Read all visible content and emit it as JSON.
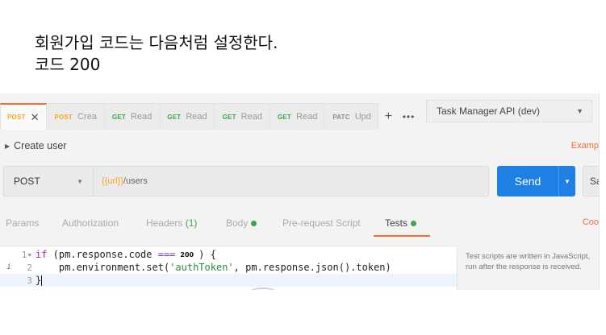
{
  "caption": {
    "line1": "회원가입 코드는 다음처럼 설정한다.",
    "line2": "코드 200"
  },
  "tabs": [
    {
      "method": "POST",
      "name": "",
      "active": true,
      "close": "✕"
    },
    {
      "method": "POST",
      "name": "Crea"
    },
    {
      "method": "GET",
      "name": "Read"
    },
    {
      "method": "GET",
      "name": "Read"
    },
    {
      "method": "GET",
      "name": "Read"
    },
    {
      "method": "GET",
      "name": "Read"
    },
    {
      "method": "PATC",
      "name": "Upd"
    }
  ],
  "tab_add": "+",
  "tab_more": "•••",
  "environment": {
    "label": "Task Manager API (dev)",
    "caret": "▼"
  },
  "request": {
    "name": "Create user",
    "examples_label": "Examp",
    "method": "POST",
    "method_caret": "▼",
    "url_var": "{{url}}",
    "url_path": "/users",
    "send_label": "Send",
    "send_caret": "▼",
    "save_label": "Sa"
  },
  "subtabs": {
    "params": "Params",
    "authorization": "Authorization",
    "headers": "Headers",
    "headers_count": "(1)",
    "body": "Body",
    "prerequest": "Pre-request Script",
    "tests": "Tests",
    "cookies": "Coo"
  },
  "editor": {
    "ln1": "1",
    "fold": "▾",
    "ln2": "2",
    "ln3": "3",
    "info_marker": "i",
    "l1_kw": "if",
    "l1_a": " (pm.response.code ",
    "l1_op": "===",
    "l1_val": "200",
    "l1_b": ") {",
    "l2_a": "pm.environment.set(",
    "l2_str": "'authToken'",
    "l2_b": ", pm.response.json().token)",
    "l3_a": "}"
  },
  "help_text": "Test scripts are written in JavaScript, run after the response is received.",
  "colors": {
    "accent": "#f26b3a",
    "send": "#1e7fe5",
    "post": "#f6a623",
    "get": "#3fa34d"
  }
}
